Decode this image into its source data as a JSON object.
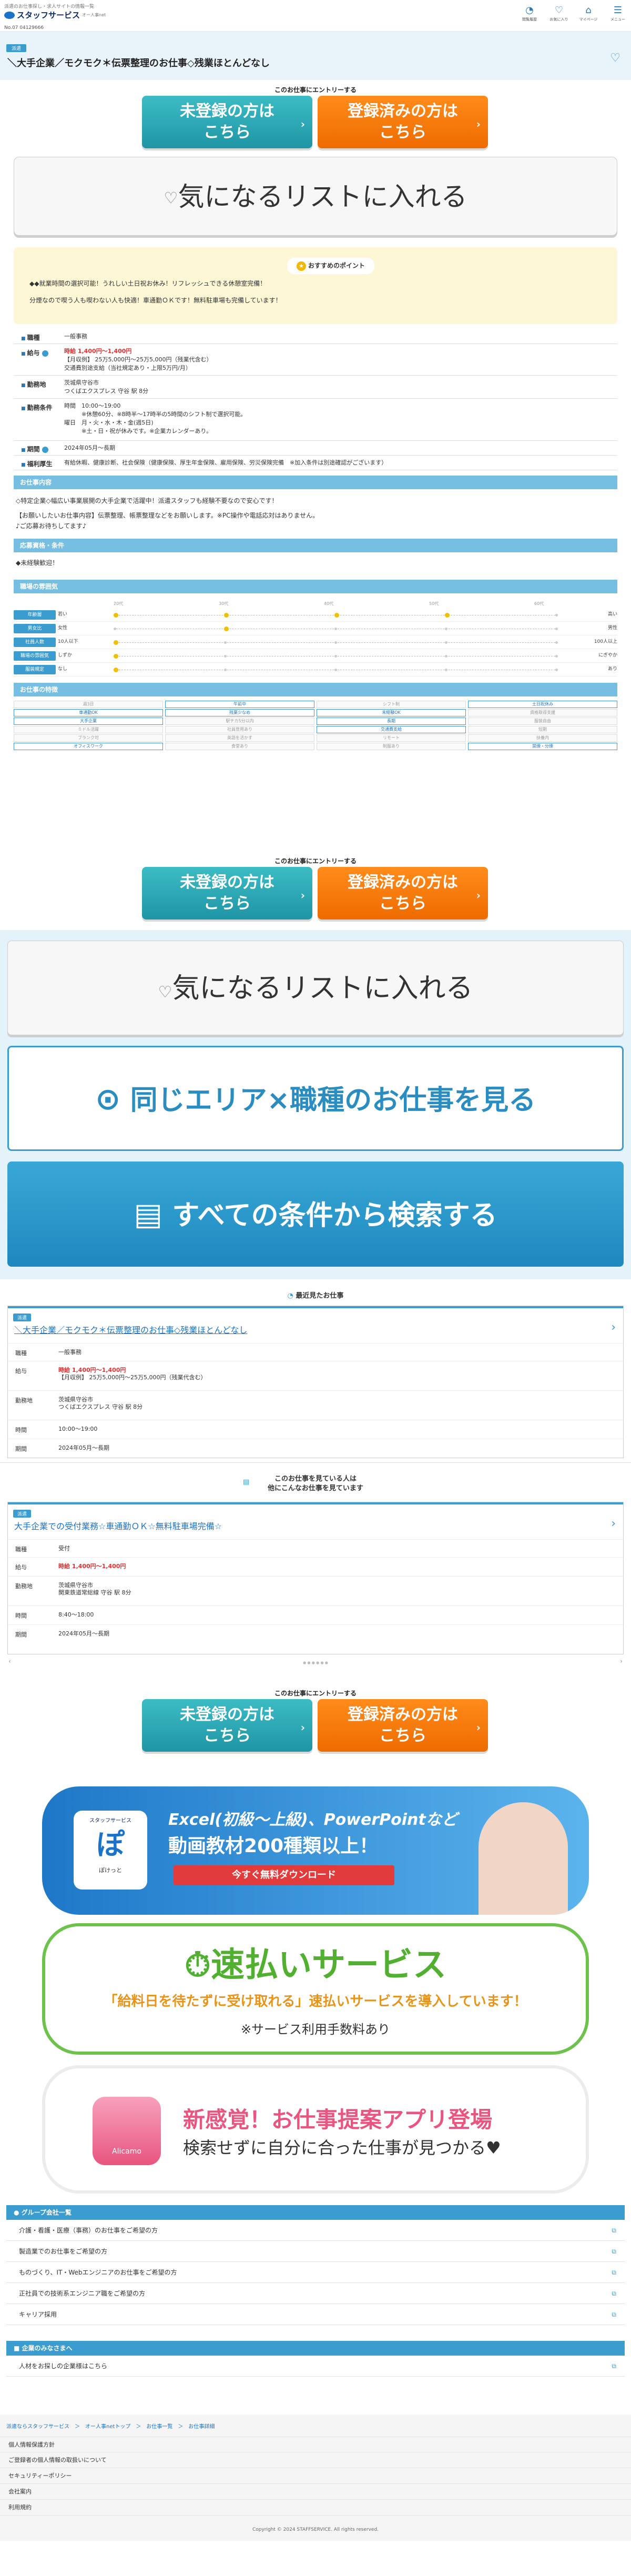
{
  "header": {
    "tagline": "派遣のお仕事探し・求人サイトの情報一覧",
    "logo": "スタッフサービス",
    "logo_sub": "オー人事net",
    "job_id": "No.07 04129666",
    "icons": [
      {
        "label": "閲覧履歴",
        "icon": "clock-icon"
      },
      {
        "label": "お気に入り",
        "icon": "heart-icon"
      },
      {
        "label": "マイページ",
        "icon": "home-icon"
      },
      {
        "label": "メニュー",
        "icon": "menu-icon"
      }
    ]
  },
  "title": {
    "pill": "派遣",
    "text": "＼大手企業／モクモク＊伝票整理のお仕事◇残業ほとんどなし"
  },
  "entry": {
    "caption": "このお仕事にエントリーする",
    "unregistered": "未登録の方は\nこちら",
    "registered": "登録済みの方は\nこちら"
  },
  "fav": {
    "label": "気になるリストに入れる"
  },
  "recommend": {
    "badge": "おすすめのポイント",
    "line1": "◆◆就業時間の選択可能！うれしい土日祝お休み！リフレッシュできる休憩室完備！",
    "line2": "分煙なので喫う人も喫わない人も快適！車通勤ＯＫです！無料駐車場も完備しています！"
  },
  "details": [
    {
      "k": "職種",
      "v": [
        "一般事務"
      ]
    },
    {
      "k": "給与",
      "v": [
        "時給 1,400円〜1,400円",
        "【月収例】 25万5,000円〜25万5,000円（残業代含む）",
        "交通費別途支給（当社規定あり・上限5万円/月）"
      ]
    },
    {
      "k": "勤務地",
      "v": [
        "茨城県守谷市",
        "つくばエクスプレス 守谷 駅 8分"
      ]
    },
    {
      "k": "勤務条件",
      "v": [
        "時間　10:00〜19:00",
        "　　　※休憩60分、※8時半〜17時半の5時間のシフト制で選択可能。",
        "曜日　月・火・水・木・金(週5日)",
        "　　　※土・日・祝が休みです。※企業カレンダーあり。"
      ]
    },
    {
      "k": "期間",
      "v": [
        "2024年05月〜長期"
      ]
    },
    {
      "k": "福利厚生",
      "v": [
        "有給休暇、健康診断、社会保険（健康保険、厚生年金保険、雇用保険、労災保険完備　※加入条件は別途確認がございます）"
      ]
    }
  ],
  "about": {
    "heading": "お仕事内容",
    "line1": "◇特定企業◇幅広い事業展開の大手企業で活躍中！派遣スタッフも経験不要なので安心です！",
    "line2": "【お願いしたいお仕事内容】伝票整理、帳票整理などをお願いします。※PC操作や電話応対はありません。",
    "line3": "♪ご応募お待ちしてます♪"
  },
  "skills": {
    "heading": "応募資格・条件",
    "text": "◆未経験歓迎！"
  },
  "env": {
    "heading": "職場の雰囲気",
    "cols": [
      "20代",
      "30代",
      "40代",
      "50代",
      "60代"
    ],
    "rows": [
      {
        "label": "年齢層",
        "left": "若い",
        "right": "高い",
        "level": 0.25
      },
      {
        "label": "男女比",
        "left": "女性",
        "right": "男性",
        "level": 0.25
      },
      {
        "label": "社員人数",
        "left": "10人以下",
        "right": "100人以上",
        "level": 0.0
      },
      {
        "label": "職場の雰囲気",
        "left": "しずか",
        "right": "にぎやか",
        "level": 0.0
      },
      {
        "label": "服装規定",
        "left": "なし",
        "right": "あり",
        "level": 0.0
      }
    ]
  },
  "features": {
    "heading": "お仕事の特徴",
    "items": [
      {
        "t": "週3日",
        "on": false
      },
      {
        "t": "午前中",
        "on": true
      },
      {
        "t": "シフト制",
        "on": false
      },
      {
        "t": "土日祝休み",
        "on": true
      },
      {
        "t": "車通勤OK",
        "on": true
      },
      {
        "t": "残業少なめ",
        "on": true
      },
      {
        "t": "未経験OK",
        "on": true
      },
      {
        "t": "資格取得支援",
        "on": false
      },
      {
        "t": "大手企業",
        "on": true
      },
      {
        "t": "駅チカ5分以内",
        "on": false
      },
      {
        "t": "長期",
        "on": true
      },
      {
        "t": "服装自由",
        "on": false
      },
      {
        "t": "ミドル活躍",
        "on": false
      },
      {
        "t": "社員登用あり",
        "on": false
      },
      {
        "t": "交通費支給",
        "on": true
      },
      {
        "t": "短期",
        "on": false
      },
      {
        "t": "ブランク可",
        "on": false
      },
      {
        "t": "英語を活かす",
        "on": false
      },
      {
        "t": "リモート",
        "on": false
      },
      {
        "t": "扶養内",
        "on": false
      },
      {
        "t": "オフィスワーク",
        "on": true
      },
      {
        "t": "食堂あり",
        "on": false
      },
      {
        "t": "制服あり",
        "on": false
      },
      {
        "t": "禁煙・分煙",
        "on": true
      }
    ]
  },
  "buttons": {
    "fav": "気になるリストに入れる",
    "area": "同じエリア×職種のお仕事を見る",
    "search": "すべての条件から検索する"
  },
  "recent": {
    "heading": "最近見たお仕事",
    "pill": "派遣",
    "title": "＼大手企業／モクモク＊伝票整理のお仕事◇残業ほとんどなし",
    "rows": [
      {
        "k": "職種",
        "v": [
          "一般事務"
        ]
      },
      {
        "k": "給与",
        "v": [
          "時給 1,400円〜1,400円",
          "【月収例】 25万5,000円〜25万5,000円（残業代含む）"
        ]
      },
      {
        "k": "勤務地",
        "v": [
          "茨城県守谷市",
          "つくばエクスプレス 守谷 駅 8分"
        ]
      },
      {
        "k": "時間",
        "v": [
          "10:00〜19:00"
        ]
      },
      {
        "k": "期間",
        "v": [
          "2024年05月〜長期"
        ]
      }
    ]
  },
  "also": {
    "heading1": "このお仕事を見ている人は",
    "heading2": "他にこんなお仕事を見ています",
    "pill": "派遣",
    "title": "大手企業での受付業務☆車通勤ＯＫ☆無料駐車場完備☆",
    "rows": [
      {
        "k": "職種",
        "v": [
          "受付"
        ]
      },
      {
        "k": "給与",
        "v": [
          "時給 1,400円〜1,400円"
        ]
      },
      {
        "k": "勤務地",
        "v": [
          "茨城県守谷市",
          "関東鉄道常総線 守谷 駅 8分"
        ]
      },
      {
        "k": "時間",
        "v": [
          "8:40〜18:00"
        ]
      },
      {
        "k": "期間",
        "v": [
          "2024年05月〜長期"
        ]
      }
    ],
    "dots": "● ● ● ● ● ●"
  },
  "banners": {
    "potto_brand": "スタッフサービス",
    "potto_name": "ぽけっと",
    "potto_line1": "Excel(初級〜上級)、PowerPointなど",
    "potto_line2": "動画教材200種類以上！",
    "potto_cta": "今すぐ無料ダウンロード",
    "haya_title": "速払いサービス",
    "haya_sub": "「給料日を待たずに受け取れる」速払いサービスを導入しています！",
    "haya_note": "※サービス利用手数料あり",
    "ali_name": "Alicamo",
    "ali_title": "新感覚！お仕事提案アプリ登場",
    "ali_sub": "検索せずに自分に合った仕事が見つかる♥"
  },
  "group": {
    "heading": "グループ会社一覧",
    "items": [
      "介護・看護・医療（事務）のお仕事をご希望の方",
      "製造業でのお仕事をご希望の方",
      "ものづくり、IT・Webエンジニアのお仕事をご希望の方",
      "正社員での技術系エンジニア職をご希望の方",
      "キャリア採用"
    ]
  },
  "corp": {
    "heading": "企業のみなさまへ",
    "items": [
      "人材をお探しの企業様はこちら"
    ]
  },
  "breadcrumb": "派遣ならスタッフサービス　＞　オー人事netトップ　＞　お仕事一覧　＞　お仕事詳細",
  "footer": {
    "links": [
      "個人情報保護方針",
      "ご登録者の個人情報の取扱いについて",
      "セキュリティーポリシー",
      "会社案内",
      "利用規約"
    ],
    "copyright": "Copyright © 2024 STAFFSERVICE. All rights reserved."
  },
  "colors": {
    "accent": "#3b9ccf",
    "teal": "#2aaab8",
    "orange": "#f47b0a",
    "red": "#e03030"
  }
}
